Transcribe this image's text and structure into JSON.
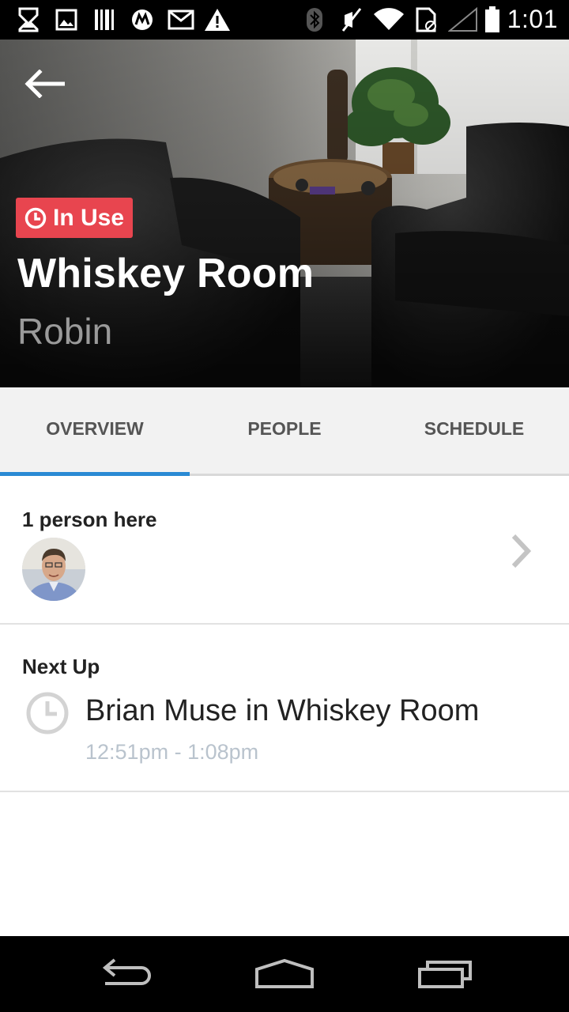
{
  "status_bar": {
    "time": "1:01",
    "left_icons": [
      "notification-icon",
      "gallery-icon",
      "barcode-icon",
      "motorola-icon",
      "gmail-icon",
      "warning-icon"
    ],
    "right_icons": [
      "bluetooth-icon",
      "muted-icon",
      "wifi-icon",
      "sim-icon",
      "signal-icon",
      "battery-icon"
    ]
  },
  "hero": {
    "status_badge": "In Use",
    "badge_color": "#e8454f",
    "room_name": "Whiskey Room",
    "organization": "Robin"
  },
  "tabs": [
    {
      "label": "OVERVIEW",
      "active": true
    },
    {
      "label": "PEOPLE",
      "active": false
    },
    {
      "label": "SCHEDULE",
      "active": false
    }
  ],
  "accent_color": "#2a8ad4",
  "people": {
    "heading": "1 person here"
  },
  "next_up": {
    "heading": "Next Up",
    "event_title": "Brian Muse in Whiskey Room",
    "event_time": "12:51pm - 1:08pm"
  },
  "nav_bar": {
    "buttons": [
      "back-icon",
      "home-icon",
      "recents-icon"
    ]
  }
}
